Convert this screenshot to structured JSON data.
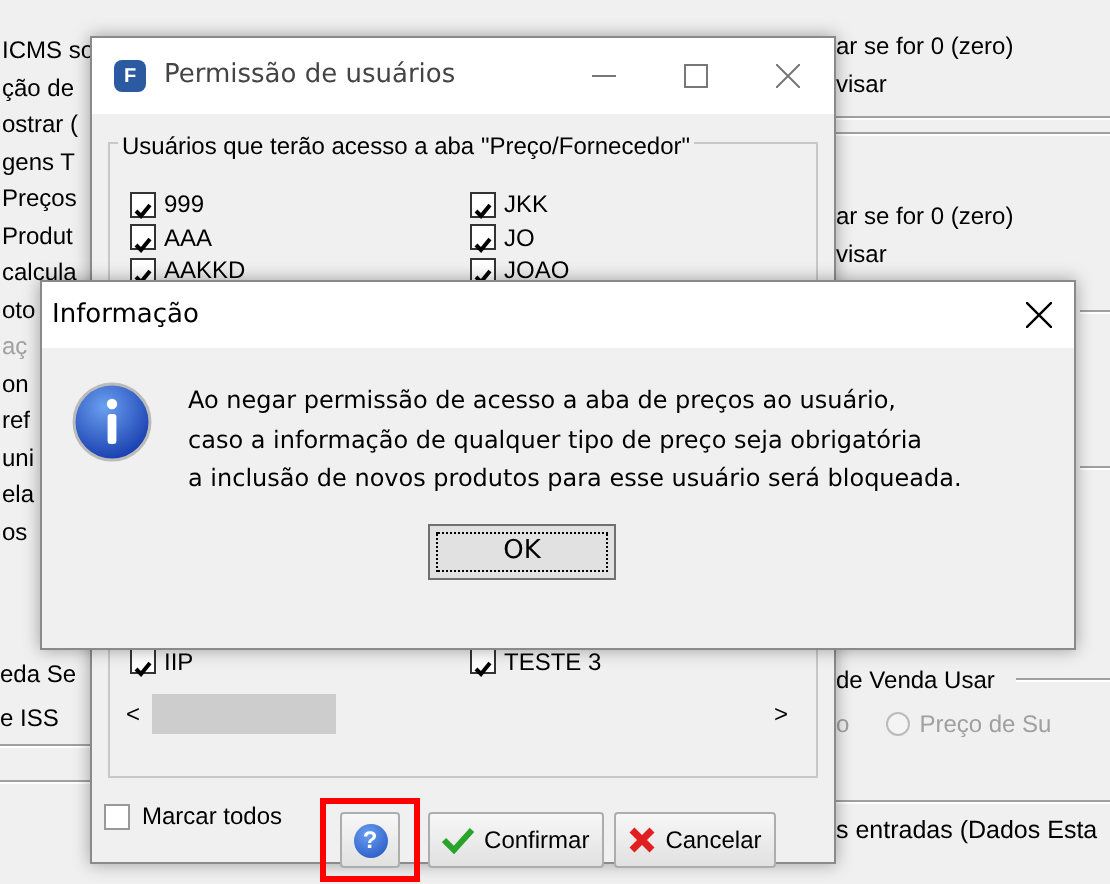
{
  "background": {
    "left_labels": [
      {
        "label": "ICMS so",
        "disabled": false
      },
      {
        "label": "ção de",
        "disabled": false
      },
      {
        "label": "ostrar (",
        "disabled": false
      },
      {
        "label": "gens T",
        "disabled": false
      },
      {
        "label": "Preços",
        "disabled": false
      },
      {
        "label": "Produt",
        "disabled": false
      },
      {
        "label": "calcula",
        "disabled": false
      },
      {
        "label": "oto",
        "disabled": false
      },
      {
        "label": "aç",
        "disabled": true
      },
      {
        "label": "on",
        "disabled": false
      },
      {
        "label": "ref",
        "disabled": false
      },
      {
        "label": "uni",
        "disabled": false
      },
      {
        "label": "ela",
        "disabled": false
      },
      {
        "label": "os",
        "disabled": false
      }
    ],
    "left_lower_labels": [
      {
        "label": "eda Se"
      },
      {
        "label": "e ISS"
      }
    ],
    "right_upper_labels": [
      {
        "label": "ar se for 0 (zero)"
      },
      {
        "label": "visar"
      }
    ],
    "right_middle_labels": [
      {
        "label": "ar se for 0 (zero)"
      },
      {
        "label": "visar"
      }
    ],
    "price_group": {
      "legend": "de Venda Usar",
      "options": [
        {
          "kind": "text",
          "label": "o"
        },
        {
          "kind": "radio",
          "label": "Preço de Su",
          "selected": false
        }
      ]
    },
    "bottom_label": "s entradas (Dados Esta"
  },
  "permission_window": {
    "icon_letter": "F",
    "title": "Permissão de usuários",
    "group_label": "Usuários que terão acesso a aba \"Preço/Fornecedor\"",
    "users_top": [
      {
        "label": "999",
        "checked": true
      },
      {
        "label": "JKK",
        "checked": true
      },
      {
        "label": "AAA",
        "checked": true
      },
      {
        "label": "JO",
        "checked": true
      },
      {
        "label": "AAKKD",
        "checked": true
      },
      {
        "label": "JOAO",
        "checked": true
      }
    ],
    "users_bottom": [
      {
        "label": "IIP",
        "checked": true
      },
      {
        "label": "TESTE 3",
        "checked": true
      }
    ],
    "select_all": {
      "label": "Marcar todos",
      "checked": false
    },
    "scroll_left": "<",
    "scroll_right": ">",
    "help_button": {
      "label": "?",
      "highlighted": true
    },
    "confirm_label": "Confirmar",
    "cancel_label": "Cancelar"
  },
  "info_dialog": {
    "title": "Informação",
    "message_lines": [
      "Ao negar permissão de acesso a aba de preços ao usuário,",
      "caso a informação de qualquer tipo de preço seja obrigatória",
      "a inclusão de novos produtos para esse usuário será bloqueada."
    ],
    "ok_label": "OK"
  }
}
